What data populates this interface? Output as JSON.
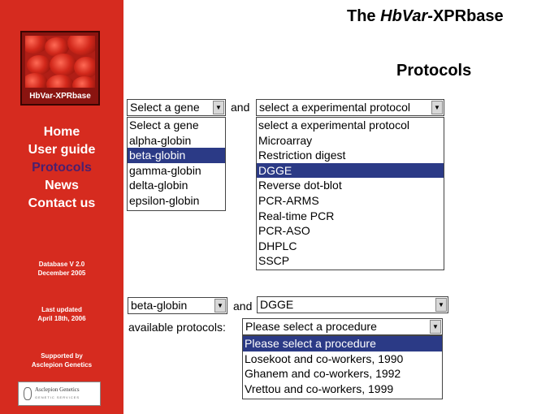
{
  "sidebar": {
    "logo_text": "HbVar-XPRbase",
    "nav": [
      "Home",
      "User guide",
      "Protocols",
      "News",
      "Contact us"
    ],
    "active_nav": "Protocols",
    "db_version": "Database V 2.0",
    "db_date": "December 2005",
    "updated_label": "Last updated",
    "updated_date": "April 18th, 2006",
    "supported_label": "Supported by",
    "supported_by": "Asclepion Genetics",
    "badge_text": "Asclepion Genetics",
    "badge_sub": "GENETIC SERVICES"
  },
  "header": {
    "title_prefix": "The ",
    "title_italic": "HbVar",
    "title_suffix": "-XPRbase",
    "page_title": "Protocols"
  },
  "form1": {
    "gene_select_value": "Select a gene",
    "and_label": "and",
    "protocol_select_value": "select a experimental protocol",
    "gene_options": [
      "Select a gene",
      "alpha-globin",
      "beta-globin",
      "gamma-globin",
      "delta-globin",
      "epsilon-globin"
    ],
    "gene_selected": "beta-globin",
    "protocol_options": [
      "select a experimental protocol",
      "Microarray",
      "Restriction digest",
      "DGGE",
      "Reverse dot-blot",
      "PCR-ARMS",
      "Real-time PCR",
      "PCR-ASO",
      "DHPLC",
      "SSCP"
    ],
    "protocol_selected": "DGGE"
  },
  "form2": {
    "gene_value": "beta-globin",
    "and_label": "and",
    "protocol_value": "DGGE",
    "available_label": "available protocols:",
    "procedure_select_value": "Please select a procedure",
    "procedure_options": [
      "Please select a procedure",
      "Losekoot and co-workers, 1990",
      "Ghanem and co-workers, 1992",
      "Vrettou and co-workers, 1999"
    ],
    "procedure_selected": "Please select a procedure"
  },
  "colors": {
    "sidebar_bg": "#d62b1f",
    "active_nav": "#4a1f6e",
    "selection": "#2b3a86"
  },
  "icons": {
    "dropdown": "chevron-down-icon",
    "logo": "blood-cells-logo",
    "badge": "helix-icon"
  }
}
